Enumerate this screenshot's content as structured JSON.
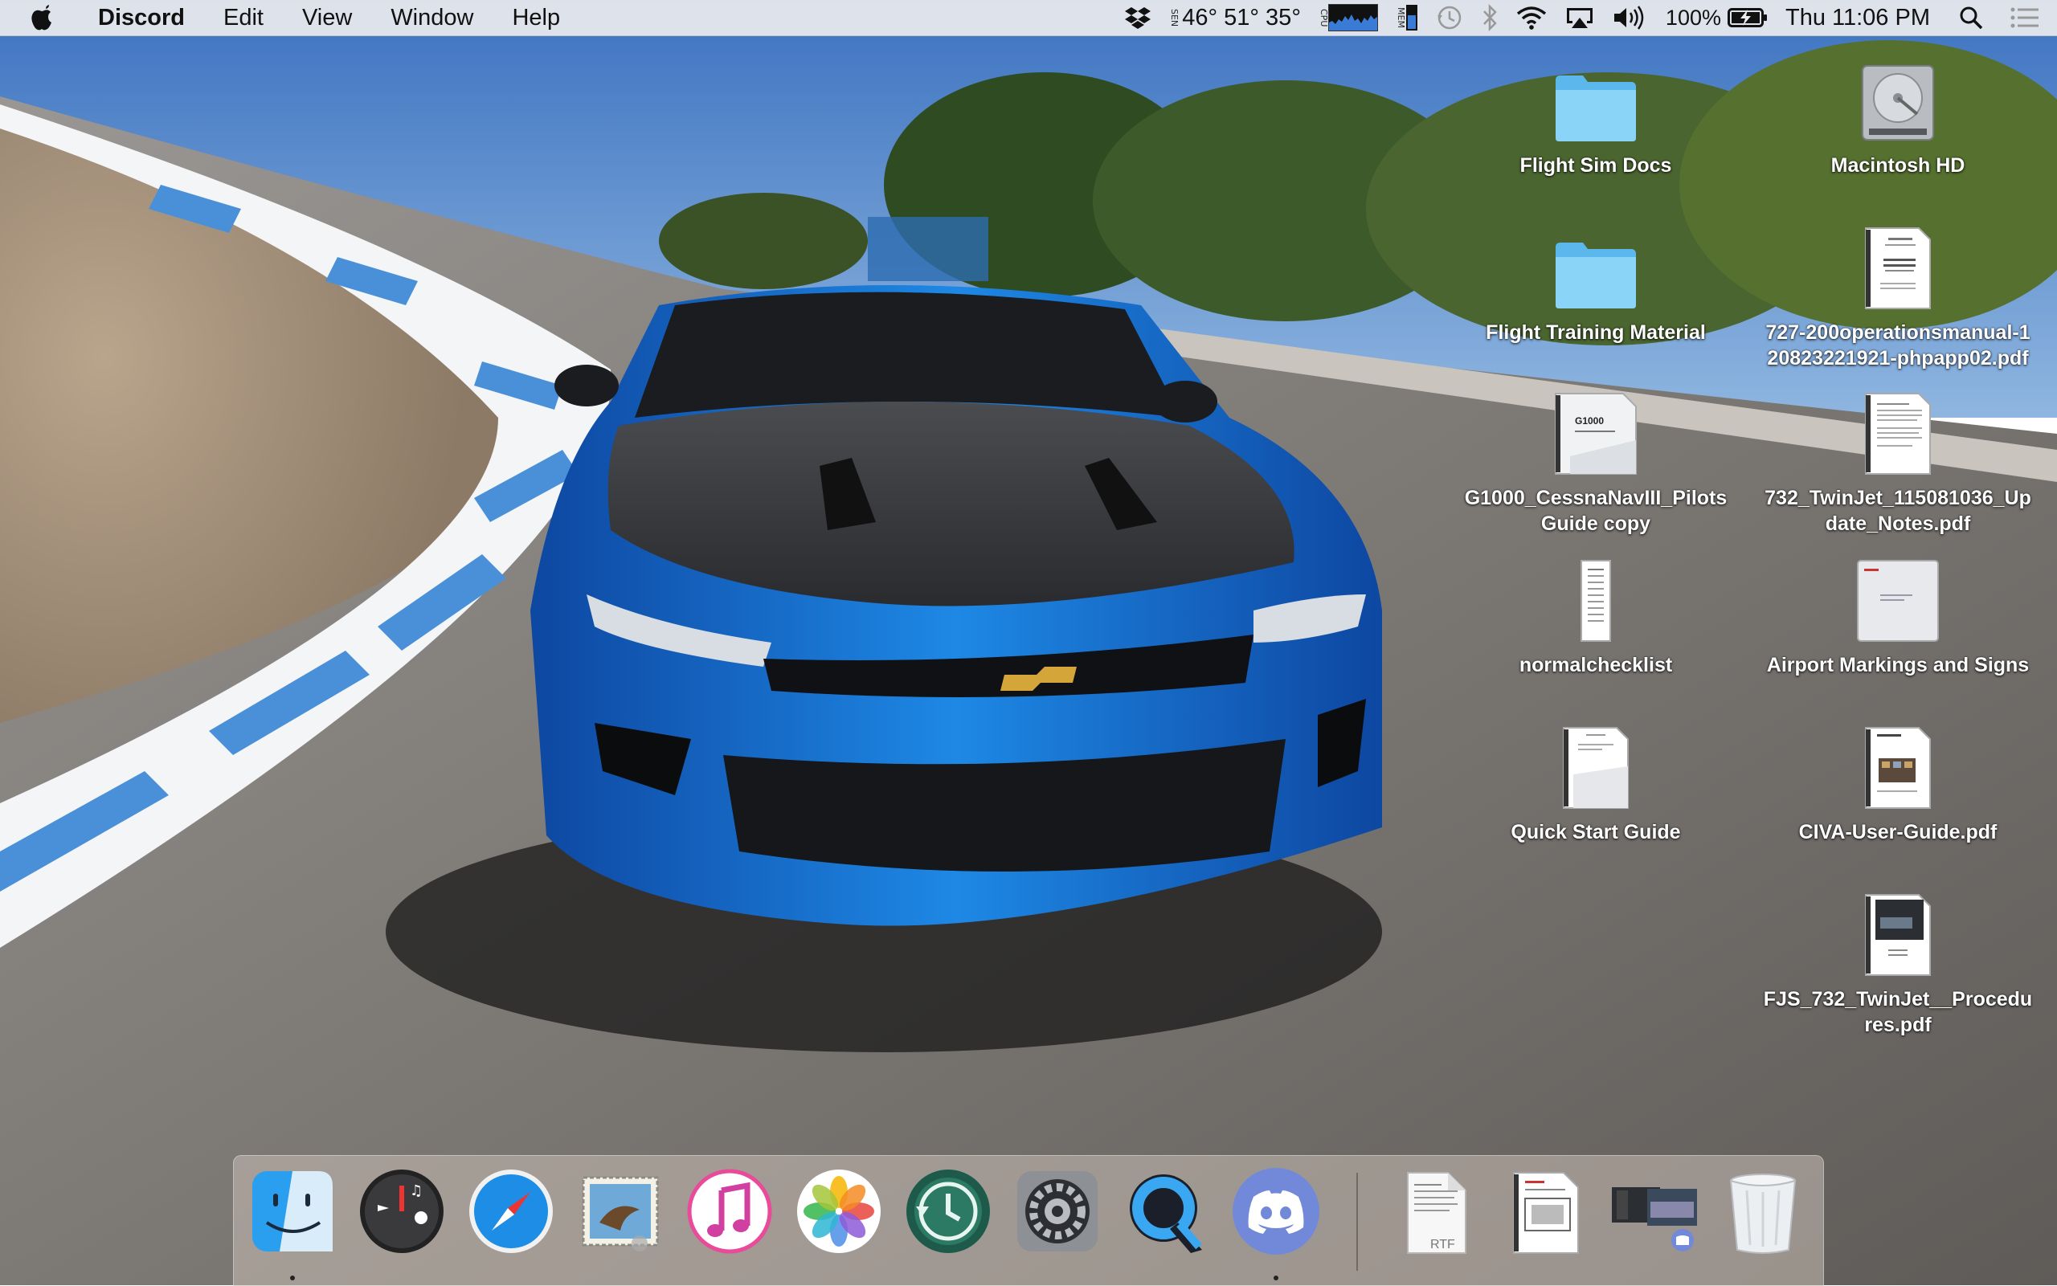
{
  "menubar": {
    "app_name": "Discord",
    "menus": [
      "Edit",
      "View",
      "Window",
      "Help"
    ],
    "sensor_label": "SEN",
    "temperatures": "46° 51° 35°",
    "cpu_label": "CPU",
    "mem_label": "MEM",
    "battery_percent": "100%",
    "clock": "Thu 11:06 PM"
  },
  "desktop": {
    "icons": [
      {
        "label": "Flight Sim Docs",
        "kind": "folder"
      },
      {
        "label": "Macintosh HD",
        "kind": "drive"
      },
      {
        "label": "Flight Training Material",
        "kind": "folder"
      },
      {
        "label": "727-200operationsmanual-120823221921-phpapp02.pdf",
        "kind": "document"
      },
      {
        "label": "G1000_CessnaNavIII_PilotsGuide copy",
        "kind": "document"
      },
      {
        "label": "732_TwinJet_115081036_Update_Notes.pdf",
        "kind": "document"
      },
      {
        "label": "normalchecklist",
        "kind": "document"
      },
      {
        "label": "Airport Markings and Signs",
        "kind": "document"
      },
      {
        "label": "Quick Start Guide",
        "kind": "document"
      },
      {
        "label": "CIVA-User-Guide.pdf",
        "kind": "document"
      },
      {
        "label": "FJS_732_TwinJet__Procedures.pdf",
        "kind": "document"
      }
    ]
  },
  "doc_thumb_text": {
    "g1000": "G1000",
    "rtf": "RTF"
  },
  "dock": {
    "apps": [
      {
        "name": "Finder",
        "icon": "finder-icon",
        "running": true
      },
      {
        "name": "Dashboard",
        "icon": "dashboard-icon",
        "running": false
      },
      {
        "name": "Safari",
        "icon": "safari-icon",
        "running": false
      },
      {
        "name": "Mail",
        "icon": "mail-icon",
        "running": false
      },
      {
        "name": "iTunes",
        "icon": "itunes-icon",
        "running": false
      },
      {
        "name": "Photos",
        "icon": "photos-icon",
        "running": false
      },
      {
        "name": "Time Machine",
        "icon": "time-machine-icon",
        "running": false
      },
      {
        "name": "System Preferences",
        "icon": "system-preferences-icon",
        "running": false
      },
      {
        "name": "QuickTime Player",
        "icon": "quicktime-icon",
        "running": false
      },
      {
        "name": "Discord",
        "icon": "discord-icon",
        "running": true
      }
    ],
    "stacks": [
      {
        "icon": "rtf-document-icon"
      },
      {
        "icon": "pdf-document-icon"
      },
      {
        "icon": "downloads-stack-icon"
      },
      {
        "icon": "trash-icon"
      }
    ]
  },
  "colors": {
    "menubar_bg": "#ececee",
    "folder_blue": "#7ccdf5",
    "car_blue": "#1565c0",
    "discord_blurple": "#7289da"
  }
}
